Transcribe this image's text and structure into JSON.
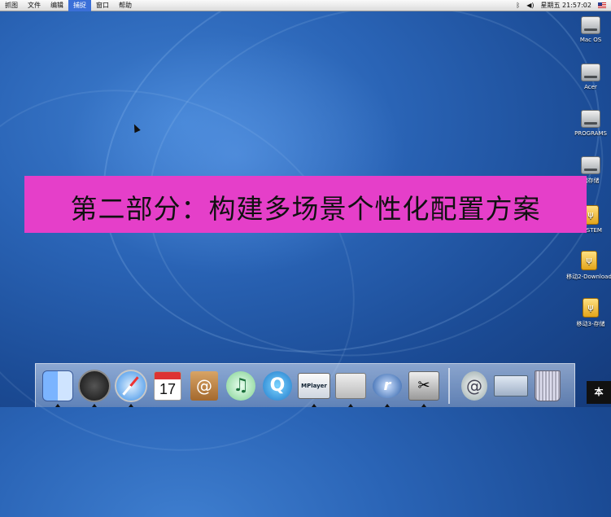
{
  "menubar": {
    "items": [
      "抓图",
      "文件",
      "编辑",
      "捕捉",
      "窗口",
      "帮助"
    ],
    "active_index": 3,
    "clock": "星期五 21:57:02",
    "icons": [
      "bluetooth-icon",
      "volume-icon",
      "flag-icon"
    ]
  },
  "desktop": {
    "drives": [
      {
        "label": "Mac OS",
        "kind": "hard-drive"
      },
      {
        "label": "Acer",
        "kind": "hard-drive"
      },
      {
        "label": "PROGRAMS",
        "kind": "hard-drive"
      },
      {
        "label": "储存储",
        "kind": "hard-drive"
      },
      {
        "label": "SYSTEM",
        "kind": "usb-drive"
      },
      {
        "label": "移动2-Download",
        "kind": "usb-drive"
      },
      {
        "label": "移动3-存储",
        "kind": "usb-drive"
      }
    ]
  },
  "banner": {
    "text": "第二部分：构建多场景个性化配置方案",
    "background": "#e53fc9"
  },
  "dock": {
    "items": [
      {
        "name": "finder",
        "label": ""
      },
      {
        "name": "dashboard",
        "label": ""
      },
      {
        "name": "safari",
        "label": ""
      },
      {
        "name": "ical",
        "label": "17"
      },
      {
        "name": "address-book",
        "label": "@"
      },
      {
        "name": "itunes",
        "label": "♫"
      },
      {
        "name": "quicktime",
        "label": "Q"
      },
      {
        "name": "mplayer",
        "label": "MPlayer"
      },
      {
        "name": "system-preferences",
        "label": ""
      },
      {
        "name": "realplayer",
        "label": "r"
      },
      {
        "name": "utilities",
        "label": "✂"
      },
      {
        "name": "mail",
        "label": "@"
      },
      {
        "name": "clipping",
        "label": ""
      },
      {
        "name": "trash",
        "label": ""
      }
    ],
    "brand_mark": "本"
  },
  "colors": {
    "wallpaper": "#2a64b6",
    "menubar_active": "#3a6fd8",
    "banner": "#e53fc9"
  }
}
